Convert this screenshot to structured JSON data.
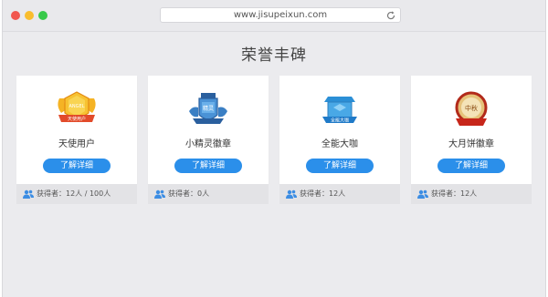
{
  "browser": {
    "url": "www.jisupeixun.com",
    "dot_colors": [
      "#f1574f",
      "#f9bd2e",
      "#38c94a"
    ]
  },
  "page": {
    "title": "荣誉丰碑"
  },
  "cards": [
    {
      "name": "天使用户",
      "button": "了解详细",
      "holders": "获得者：12人 / 100人",
      "badge_text": "ANGEL",
      "badge_ribbon": "天使用户"
    },
    {
      "name": "小精灵徽章",
      "button": "了解详细",
      "holders": "获得者：0人",
      "badge_text": "精灵"
    },
    {
      "name": "全能大咖",
      "button": "了解详细",
      "holders": "获得者：12人",
      "badge_ribbon": "全能大咖"
    },
    {
      "name": "大月饼徽章",
      "button": "了解详细",
      "holders": "获得者：12人",
      "badge_text": "中秋"
    }
  ],
  "colors": {
    "accent": "#2b8fea",
    "footer_icon": "#3c8de3"
  },
  "icons": [
    "reload-icon",
    "angel-badge-icon",
    "sprite-badge-icon",
    "expert-box-badge-icon",
    "mooncake-badge-icon",
    "users-icon"
  ]
}
